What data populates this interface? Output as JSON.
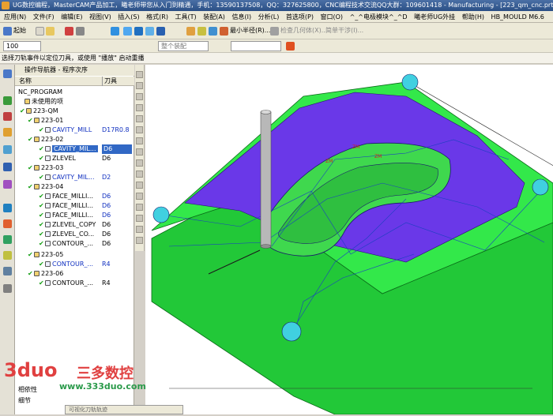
{
  "window": {
    "title": "UG数控编程，MasterCAM产品加工，曦老师带您从入门到精通，手机：13590137508，QQ：327625800，CNC编程技术交流QQ大群：109601418 - Manufacturing - [223_qm_cnc.prt （修改的）]"
  },
  "menubar": {
    "items": [
      "应用(N)",
      "文件(F)",
      "编辑(E)",
      "视图(V)",
      "插入(S)",
      "格式(R)",
      "工具(T)",
      "装配(A)",
      "信息(I)",
      "分析(L)",
      "首选项(P)",
      "窗口(O)",
      "^_^电极模块^_^D",
      "曦老师UG外挂",
      "帮助(H)",
      "HB_MOULD M6.6"
    ]
  },
  "toolbar": {
    "start_label": "起始",
    "min_radius_label": "最小半径(R)...",
    "check_geometry_label": "检查几何体(X)...",
    "simple_interference_label": "简单干涉(I)...",
    "value_field": "100",
    "whole_assembly_label": "整个装配"
  },
  "status": {
    "message": "选择刀轨事件以定位刀具，或使用 \"播放\" 启动重播"
  },
  "navigator": {
    "title": "操作导航器 - 程序次序",
    "col_name": "名称",
    "col_tool": "刀具",
    "rows": [
      {
        "name": "NC_PROGRAM",
        "tool": ""
      },
      {
        "name": "未使用的项",
        "tool": ""
      },
      {
        "name": "223-QM",
        "tool": ""
      },
      {
        "name": "223-01",
        "tool": ""
      },
      {
        "name": "CAVITY_MILL",
        "tool": "D17R0.8"
      },
      {
        "name": "223-02",
        "tool": ""
      },
      {
        "name": "CAVITY_MIL...",
        "tool": "D6"
      },
      {
        "name": "ZLEVEL",
        "tool": "D6"
      },
      {
        "name": "223-03",
        "tool": ""
      },
      {
        "name": "CAVITY_MIL...",
        "tool": "D2"
      },
      {
        "name": "223-04",
        "tool": ""
      },
      {
        "name": "FACE_MILLI...",
        "tool": "D6"
      },
      {
        "name": "FACE_MILLI...",
        "tool": "D6"
      },
      {
        "name": "FACE_MILLI...",
        "tool": "D6"
      },
      {
        "name": "ZLEVEL_COPY",
        "tool": "D6"
      },
      {
        "name": "ZLEVEL_CO...",
        "tool": "D6"
      },
      {
        "name": "CONTOUR_...",
        "tool": "D6"
      },
      {
        "name": "223-05",
        "tool": ""
      },
      {
        "name": "CONTOUR_...",
        "tool": "R4"
      },
      {
        "name": "223-06",
        "tool": ""
      },
      {
        "name": "CONTOUR_...",
        "tool": "R4"
      }
    ],
    "bottom_1": "相依性",
    "bottom_2": "细节"
  },
  "watermark": {
    "brand": "3duo",
    "chinese": "三多数控",
    "url": "www.333duo.com"
  },
  "taskbar": {
    "label": "可视化刀轨轨迹"
  },
  "colors": {
    "face_green": "#2ee83c",
    "face_purple": "#6a38e8",
    "tool_gray": "#b0b0b0",
    "accent_blue": "#3168c5"
  }
}
